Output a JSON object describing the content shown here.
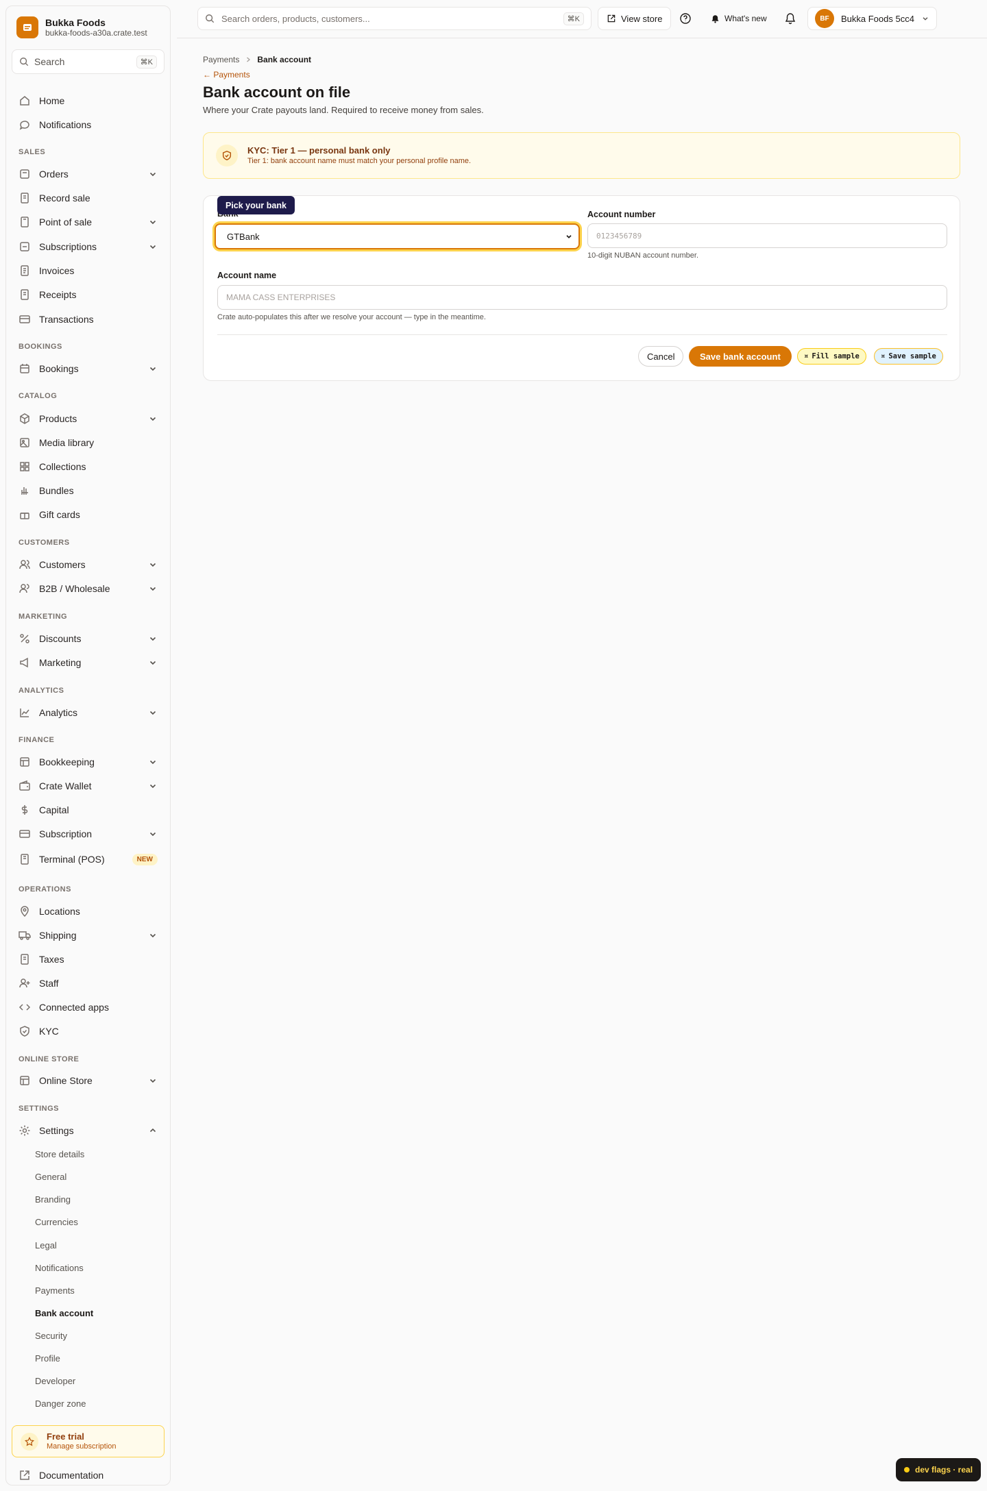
{
  "brand": {
    "name": "Bukka Foods",
    "domain": "bukka-foods-a30a.crate.test"
  },
  "sidebar_search": {
    "placeholder": "Search",
    "shortcut": "⌘K"
  },
  "nav": {
    "home": "Home",
    "notifications": "Notifications",
    "sections": {
      "sales": "SALES",
      "bookings": "BOOKINGS",
      "catalog": "CATALOG",
      "customers": "CUSTOMERS",
      "marketing": "MARKETING",
      "analytics": "ANALYTICS",
      "finance": "FINANCE",
      "operations": "OPERATIONS",
      "online_store": "ONLINE STORE",
      "settings": "SETTINGS"
    },
    "orders": "Orders",
    "record_sale": "Record sale",
    "point_of_sale": "Point of sale",
    "subscriptions": "Subscriptions",
    "invoices": "Invoices",
    "receipts": "Receipts",
    "transactions": "Transactions",
    "bookings": "Bookings",
    "products": "Products",
    "media_library": "Media library",
    "collections": "Collections",
    "bundles": "Bundles",
    "gift_cards": "Gift cards",
    "customers": "Customers",
    "b2b": "B2B / Wholesale",
    "discounts": "Discounts",
    "marketing": "Marketing",
    "analytics": "Analytics",
    "bookkeeping": "Bookkeeping",
    "crate_wallet": "Crate Wallet",
    "capital": "Capital",
    "subscription": "Subscription",
    "terminal": "Terminal (POS)",
    "new_badge": "NEW",
    "locations": "Locations",
    "shipping": "Shipping",
    "taxes": "Taxes",
    "staff": "Staff",
    "connected_apps": "Connected apps",
    "kyc": "KYC",
    "online_store": "Online Store",
    "settings": "Settings",
    "settings_sub": [
      "Store details",
      "General",
      "Branding",
      "Currencies",
      "Legal",
      "Notifications",
      "Payments",
      "Bank account",
      "Security",
      "Profile",
      "Developer",
      "Danger zone"
    ],
    "settings_active": "Bank account",
    "documentation": "Documentation"
  },
  "trial": {
    "title": "Free trial",
    "subtitle": "Manage subscription"
  },
  "topbar": {
    "search_placeholder": "Search orders, products, customers...",
    "search_shortcut": "⌘K",
    "view_store": "View store",
    "whats_new": "What's new",
    "avatar_initials": "BF",
    "store_switcher": "Bukka Foods 5cc4"
  },
  "page": {
    "breadcrumb_parent": "Payments",
    "breadcrumb_current": "Bank account",
    "back_link": "← Payments",
    "title": "Bank account on file",
    "subtitle": "Where your Crate payouts land. Required to receive money from sales."
  },
  "kyc_notice": {
    "title": "KYC: Tier 1 — personal bank only",
    "subtitle": "Tier 1: bank account name must match your personal profile name."
  },
  "form": {
    "tooltip": "Pick your bank",
    "bank_label": "Bank",
    "bank_value": "GTBank",
    "account_number_label": "Account number",
    "account_number_placeholder": "0123456789",
    "account_number_hint": "10-digit NUBAN account number.",
    "account_name_label": "Account name",
    "account_name_placeholder": "MAMA CASS ENTERPRISES",
    "account_name_hint": "Crate auto-populates this after we resolve your account — type in the meantime.",
    "cancel": "Cancel",
    "save": "Save bank account",
    "fill_sample": "Fill sample",
    "save_sample": "Save sample"
  },
  "dev_flags": "dev flags · real",
  "colors": {
    "accent": "#d97706",
    "tooltip_bg": "#1e1b4b",
    "kyc_bg": "#fffbeb"
  }
}
